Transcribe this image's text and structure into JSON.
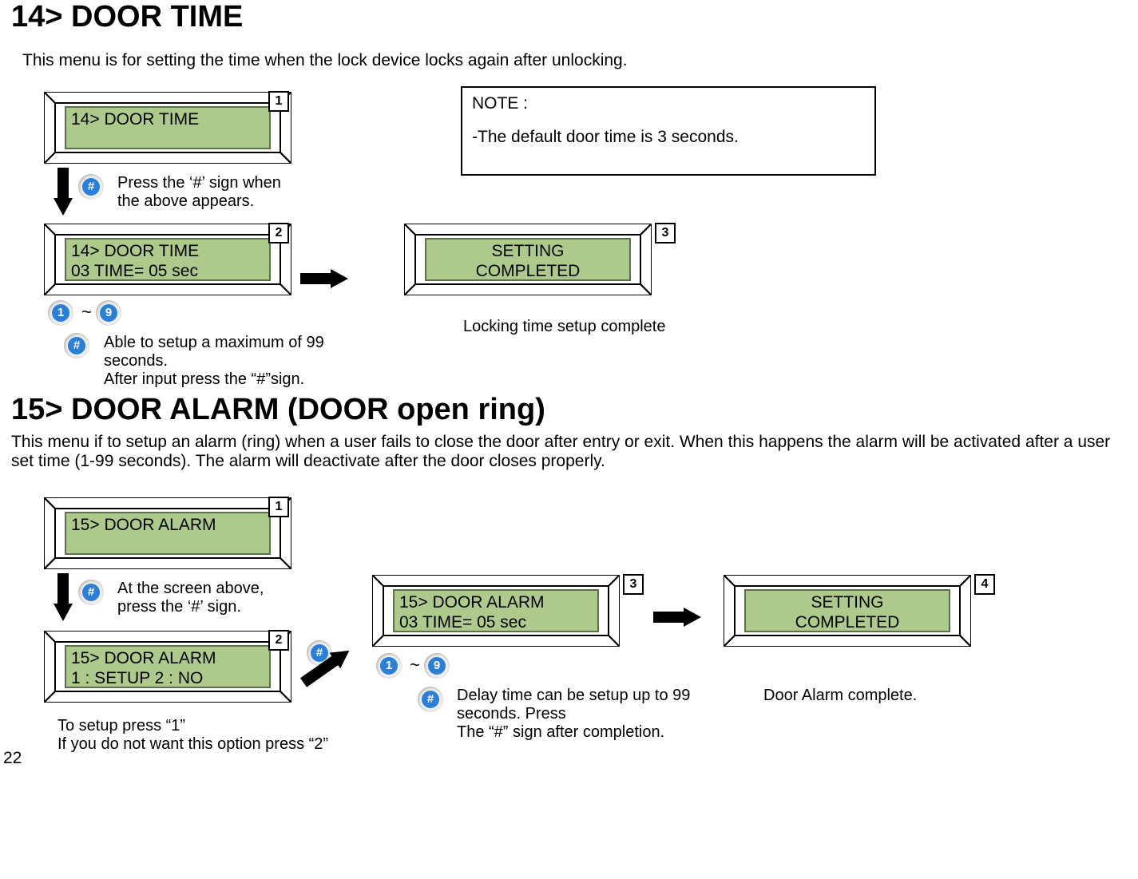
{
  "page_number": "22",
  "section14": {
    "title": "14> DOOR TIME",
    "intro": "This menu is for setting the time when the lock device locks again after unlocking.",
    "note_title": "NOTE :",
    "note_body": "-The default door time is 3 seconds.",
    "step1": {
      "badge": "1",
      "lcd_line1": "14> DOOR TIME",
      "press_text": "Press the ‘#’ sign when the above appears."
    },
    "step2": {
      "badge": "2",
      "lcd_line1": "14> DOOR TIME",
      "lcd_line2": " 03 TIME= 05 sec",
      "range_tilde": "~",
      "digits_low": "1",
      "digits_high": "9",
      "help_line1": "Able to setup a maximum of 99 seconds.",
      "help_line2": "After input press the “#”sign."
    },
    "step3": {
      "badge": "3",
      "lcd_line1": "SETTING",
      "lcd_line2": "COMPLETED",
      "caption": "Locking time setup complete"
    }
  },
  "section15": {
    "title": "15> DOOR ALARM (DOOR open ring)",
    "intro": "This menu if to setup an alarm (ring) when a user fails to close the door after entry or exit. When this happens the alarm will be activated after a user set time (1-99 seconds). The alarm will deactivate after the door closes properly.",
    "step1": {
      "badge": "1",
      "lcd_line1": "15> DOOR ALARM",
      "press_text": "At the screen above, press the ‘#’ sign."
    },
    "step2": {
      "badge": "2",
      "lcd_line1": "15> DOOR ALARM",
      "lcd_line2": " 1 : SETUP  2 : NO",
      "help_line1": "To setup press “1”",
      "help_line2": "If you do not want this option press “2”"
    },
    "step3": {
      "badge": "3",
      "lcd_line1": "15> DOOR ALARM",
      "lcd_line2": " 03 TIME=  05  sec",
      "range_tilde": "~",
      "digits_low": "1",
      "digits_high": "9",
      "help_line1": "Delay time can be setup up to 99 seconds. Press",
      "help_line2": "The “#” sign after completion."
    },
    "step4": {
      "badge": "4",
      "lcd_line1": "SETTING",
      "lcd_line2": "COMPLETED",
      "caption": "Door Alarm complete."
    }
  },
  "icons": {
    "hash": "#",
    "digit1": "1",
    "digit9": "9"
  }
}
